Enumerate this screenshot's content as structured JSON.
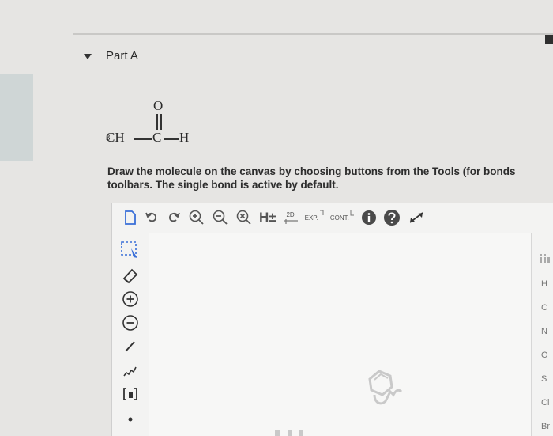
{
  "part": {
    "title": "Part A"
  },
  "formula": {
    "ch": "CH",
    "sub3": "3",
    "carbon": "C",
    "hydrogen": "H",
    "oxygen": "O"
  },
  "instructions": {
    "line1": "Draw the molecule on the canvas by choosing buttons from the Tools (for bonds",
    "line2": "toolbars. The single bond is active by default."
  },
  "toolbar": {
    "h_label": "H±",
    "twod_label": "2D",
    "exp_label": "EXP.",
    "cont_label": "CONT."
  },
  "elements": [
    "H",
    "C",
    "N",
    "O",
    "S",
    "Cl",
    "Br"
  ],
  "colors": {
    "accent": "#3a6fd8",
    "background": "#e6e5e3"
  }
}
